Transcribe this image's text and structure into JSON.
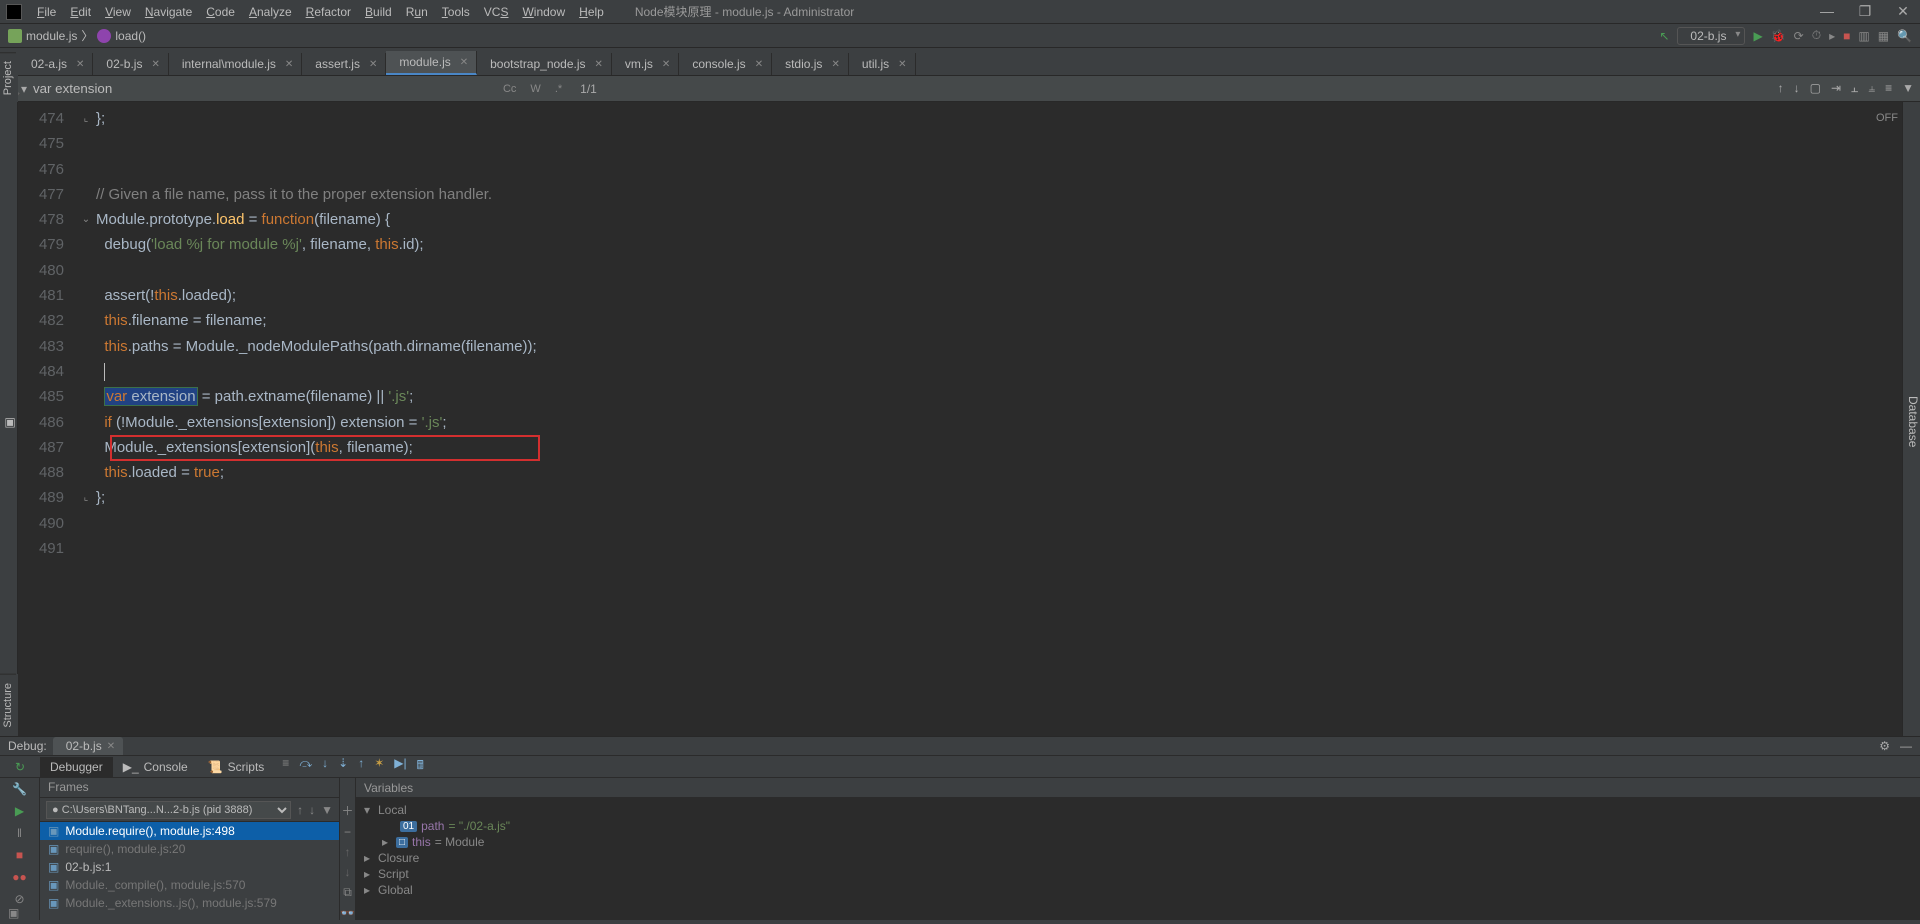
{
  "window": {
    "title": "Node模块原理 - module.js - Administrator",
    "min": "—",
    "max": "❐",
    "close": "✕"
  },
  "menu": [
    "File",
    "Edit",
    "View",
    "Navigate",
    "Code",
    "Analyze",
    "Refactor",
    "Build",
    "Run",
    "Tools",
    "VCS",
    "Window",
    "Help"
  ],
  "breadcrumb": {
    "file": "module.js",
    "method": "load()"
  },
  "runConfig": {
    "label": "02-b.js"
  },
  "tabs": [
    {
      "label": "02-a.js",
      "active": false
    },
    {
      "label": "02-b.js",
      "active": false
    },
    {
      "label": "internal\\module.js",
      "active": false
    },
    {
      "label": "assert.js",
      "active": false
    },
    {
      "label": "module.js",
      "active": true
    },
    {
      "label": "bootstrap_node.js",
      "active": false
    },
    {
      "label": "vm.js",
      "active": false
    },
    {
      "label": "console.js",
      "active": false
    },
    {
      "label": "stdio.js",
      "active": false
    },
    {
      "label": "util.js",
      "active": false
    }
  ],
  "search": {
    "query": "var extension",
    "opts": [
      "Cc",
      "W",
      ".*"
    ],
    "count": "1/1"
  },
  "editor": {
    "offLabel": "OFF",
    "lines": [
      474,
      475,
      476,
      477,
      478,
      479,
      480,
      481,
      482,
      483,
      484,
      485,
      486,
      487,
      488,
      489,
      490,
      491
    ],
    "code": {
      "l474": "};",
      "l477_cmt": "// Given a file name, pass it to the proper extension handler.",
      "l478_a": "Module.prototype.",
      "l478_load": "load",
      "l478_b": " = ",
      "l478_fn": "function",
      "l478_c": "(filename) {",
      "l479_a": "  debug(",
      "l479_s": "'load %j for module %j'",
      "l479_b": ", filename, ",
      "l479_this": "this",
      "l479_c": ".id);",
      "l481_a": "  assert(!",
      "l481_this": "this",
      "l481_b": ".loaded);",
      "l482_a": "  ",
      "l482_this": "this",
      "l482_b": ".filename = filename;",
      "l483_a": "  ",
      "l483_this": "this",
      "l483_b": ".paths = Module._nodeModulePaths(path.dirname(filename));",
      "l485_a": "  ",
      "l485_var": "var",
      "l485_sp": " ",
      "l485_ext": "extension",
      "l485_b": " = path.extname(filename) || ",
      "l485_s": "'.js'",
      "l485_c": ";",
      "l486_a": "  ",
      "l486_if": "if",
      "l486_b": " (!Module._extensions[extension]) extension = ",
      "l486_s": "'.js'",
      "l486_c": ";",
      "l487_a": "  Module._extensions[extension](",
      "l487_this": "this",
      "l487_b": ", filename);",
      "l488_a": "  ",
      "l488_this": "this",
      "l488_b": ".loaded = ",
      "l488_true": "true",
      "l488_c": ";",
      "l489": "};"
    }
  },
  "debug": {
    "label": "Debug:",
    "session": "02-b.js",
    "subtabs": [
      "Debugger",
      "Console",
      "Scripts"
    ],
    "framesHeader": "Frames",
    "threadSelect": "●  C:\\Users\\BNTang...N...2-b.js (pid 3888)",
    "frames": [
      {
        "label": "Module.require(), module.js:498",
        "sel": true,
        "dim": false
      },
      {
        "label": "require(), module.js:20",
        "sel": false,
        "dim": true
      },
      {
        "label": "02-b.js:1",
        "sel": false,
        "dim": false
      },
      {
        "label": "Module._compile(), module.js:570",
        "sel": false,
        "dim": true
      },
      {
        "label": "Module._extensions..js(), module.js:579",
        "sel": false,
        "dim": true
      }
    ],
    "varsHeader": "Variables",
    "vars": {
      "local": "Local",
      "path_k": "path",
      "path_v": " = \"./02-a.js\"",
      "this_k": "this",
      "this_v": " = Module",
      "closure": "Closure",
      "script": "Script",
      "global": "Global"
    }
  },
  "sidetabs": {
    "project": "Project",
    "structure": "Structure",
    "database": "Database"
  }
}
